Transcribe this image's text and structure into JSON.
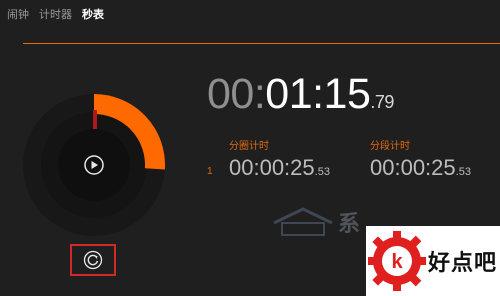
{
  "tabs": [
    {
      "label": "闹钟",
      "active": false
    },
    {
      "label": "计时器",
      "active": false
    },
    {
      "label": "秒表",
      "active": true
    }
  ],
  "colors": {
    "accent": "#e06a10",
    "highlight_border": "#d12a25",
    "background": "#1f1f1f"
  },
  "stopwatch": {
    "main_time": {
      "dim": "00:",
      "bright": "01:15",
      "fraction": ".79"
    },
    "progress_fraction": 0.26
  },
  "lap": {
    "index": "1",
    "lap_label": "分圈计时",
    "lap_time": {
      "main": "00:00:25",
      "fraction": ".53"
    },
    "split_label": "分段计时",
    "split_time": {
      "main": "00:00:25",
      "fraction": ".53"
    }
  },
  "icons": {
    "play": "play-icon",
    "reset": "reset-icon"
  },
  "watermark": {
    "text": "系"
  },
  "logo": {
    "text": "好点吧",
    "letter": "k"
  }
}
